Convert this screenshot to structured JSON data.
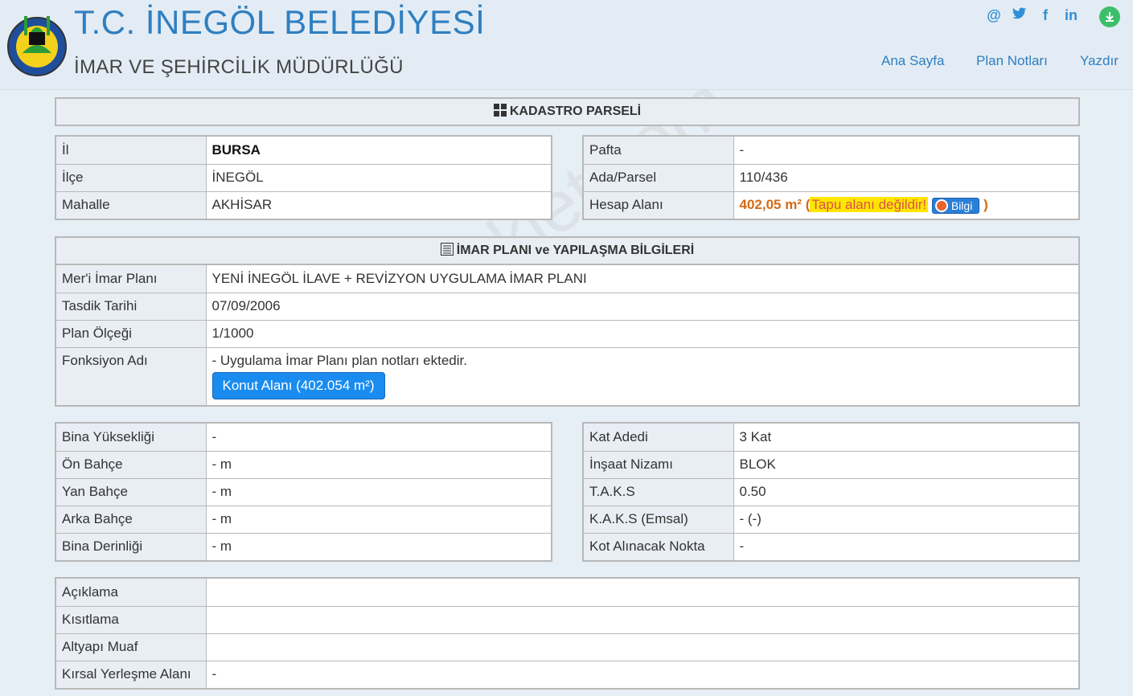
{
  "header": {
    "title": "T.C. İNEGÖL BELEDİYESİ",
    "subtitle": "İMAR VE ŞEHİRCİLİK MÜDÜRLÜĞÜ",
    "nav": [
      "Ana Sayfa",
      "Plan Notları",
      "Yazdır"
    ],
    "socials": [
      "@",
      "🐦",
      "f",
      "in"
    ]
  },
  "kadastro": {
    "title": "KADASTRO PARSELİ",
    "left": [
      {
        "label": "İl",
        "value": "BURSA"
      },
      {
        "label": "İlçe",
        "value": "İNEGÖL"
      },
      {
        "label": "Mahalle",
        "value": "AKHİSAR"
      }
    ],
    "right": [
      {
        "label": "Pafta",
        "value": "-"
      },
      {
        "label": "Ada/Parsel",
        "value": "110/436"
      },
      {
        "label": "Hesap Alanı",
        "value": "402,05 m²"
      }
    ],
    "area_open": "(",
    "area_warning": "Tapu alanı değildir!",
    "bilgi_label": "Bilgi",
    "area_close": ")"
  },
  "imar": {
    "title": "İMAR PLANI ve YAPILAŞMA BİLGİLERİ",
    "rows": [
      {
        "label": "Mer'i İmar Planı",
        "value": "YENİ İNEGÖL İLAVE + REVİZYON UYGULAMA İMAR PLANI"
      },
      {
        "label": "Tasdik Tarihi",
        "value": "07/09/2006"
      },
      {
        "label": "Plan Ölçeği",
        "value": "1/1000"
      },
      {
        "label": "Fonksiyon Adı",
        "value": "- Uygulama İmar Planı plan notları ektedir."
      }
    ],
    "function_button": "Konut Alanı (402.054 m²)"
  },
  "yapi": {
    "left": [
      {
        "label": "Bina Yüksekliği",
        "value": "-"
      },
      {
        "label": "Ön Bahçe",
        "value": "- m"
      },
      {
        "label": "Yan Bahçe",
        "value": "- m"
      },
      {
        "label": "Arka Bahçe",
        "value": "- m"
      },
      {
        "label": "Bina Derinliği",
        "value": "- m"
      }
    ],
    "right": [
      {
        "label": "Kat Adedi",
        "value": "3 Kat"
      },
      {
        "label": "İnşaat Nizamı",
        "value": "BLOK"
      },
      {
        "label": "T.A.K.S",
        "value": "0.50"
      },
      {
        "label": "K.A.K.S (Emsal)",
        "value": "- (-)"
      },
      {
        "label": "Kot Alınacak Nokta",
        "value": "-"
      }
    ]
  },
  "notes": [
    {
      "label": "Açıklama",
      "value": ""
    },
    {
      "label": "Kısıtlama",
      "value": ""
    },
    {
      "label": "Altyapı Muaf",
      "value": ""
    },
    {
      "label": "Kırsal Yerleşme Alanı",
      "value": "-"
    }
  ],
  "watermark": "emlakjet.com"
}
